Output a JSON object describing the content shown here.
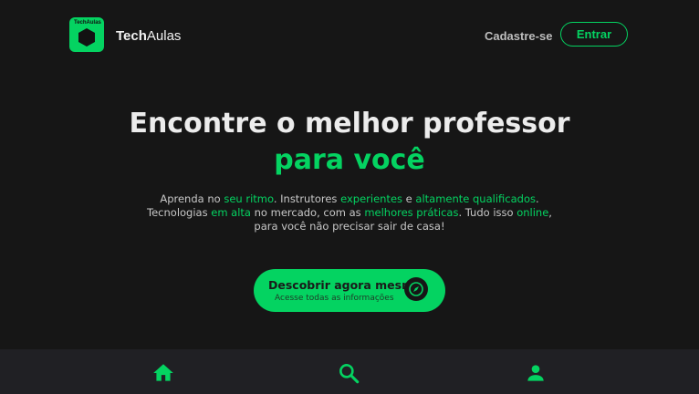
{
  "header": {
    "logo_mini_text": "TechAulas",
    "brand_bold": "Tech",
    "brand_light": "Aulas",
    "signup_label": "Cadastre-se",
    "enter_label": "Entrar"
  },
  "hero": {
    "title_line1": "Encontre o melhor professor",
    "title_line2": "para você"
  },
  "description": {
    "line1": [
      {
        "text": "Aprenda no ",
        "accent": false
      },
      {
        "text": "seu ritmo",
        "accent": true
      },
      {
        "text": ". Instrutores ",
        "accent": false
      },
      {
        "text": "experientes",
        "accent": true
      },
      {
        "text": " e ",
        "accent": false
      },
      {
        "text": "altamente qualificados",
        "accent": true
      },
      {
        "text": ".",
        "accent": false
      }
    ],
    "line2": [
      {
        "text": "Tecnologias ",
        "accent": false
      },
      {
        "text": "em alta",
        "accent": true
      },
      {
        "text": " no mercado, com as ",
        "accent": false
      },
      {
        "text": "melhores práticas",
        "accent": true
      },
      {
        "text": ". Tudo isso ",
        "accent": false
      },
      {
        "text": "online",
        "accent": true
      },
      {
        "text": ",",
        "accent": false
      }
    ],
    "line3": [
      {
        "text": "para você não precisar sair de casa!",
        "accent": false
      }
    ]
  },
  "cta": {
    "title": "Descobrir agora mesmo",
    "subtitle": "Acesse todas as informações",
    "icon": "compass-icon"
  },
  "bottom_nav": {
    "items": [
      {
        "icon": "home-icon"
      },
      {
        "icon": "search-icon"
      },
      {
        "icon": "user-icon"
      }
    ]
  },
  "colors": {
    "accent": "#04d361",
    "background": "#161616",
    "nav_background": "#202024"
  }
}
